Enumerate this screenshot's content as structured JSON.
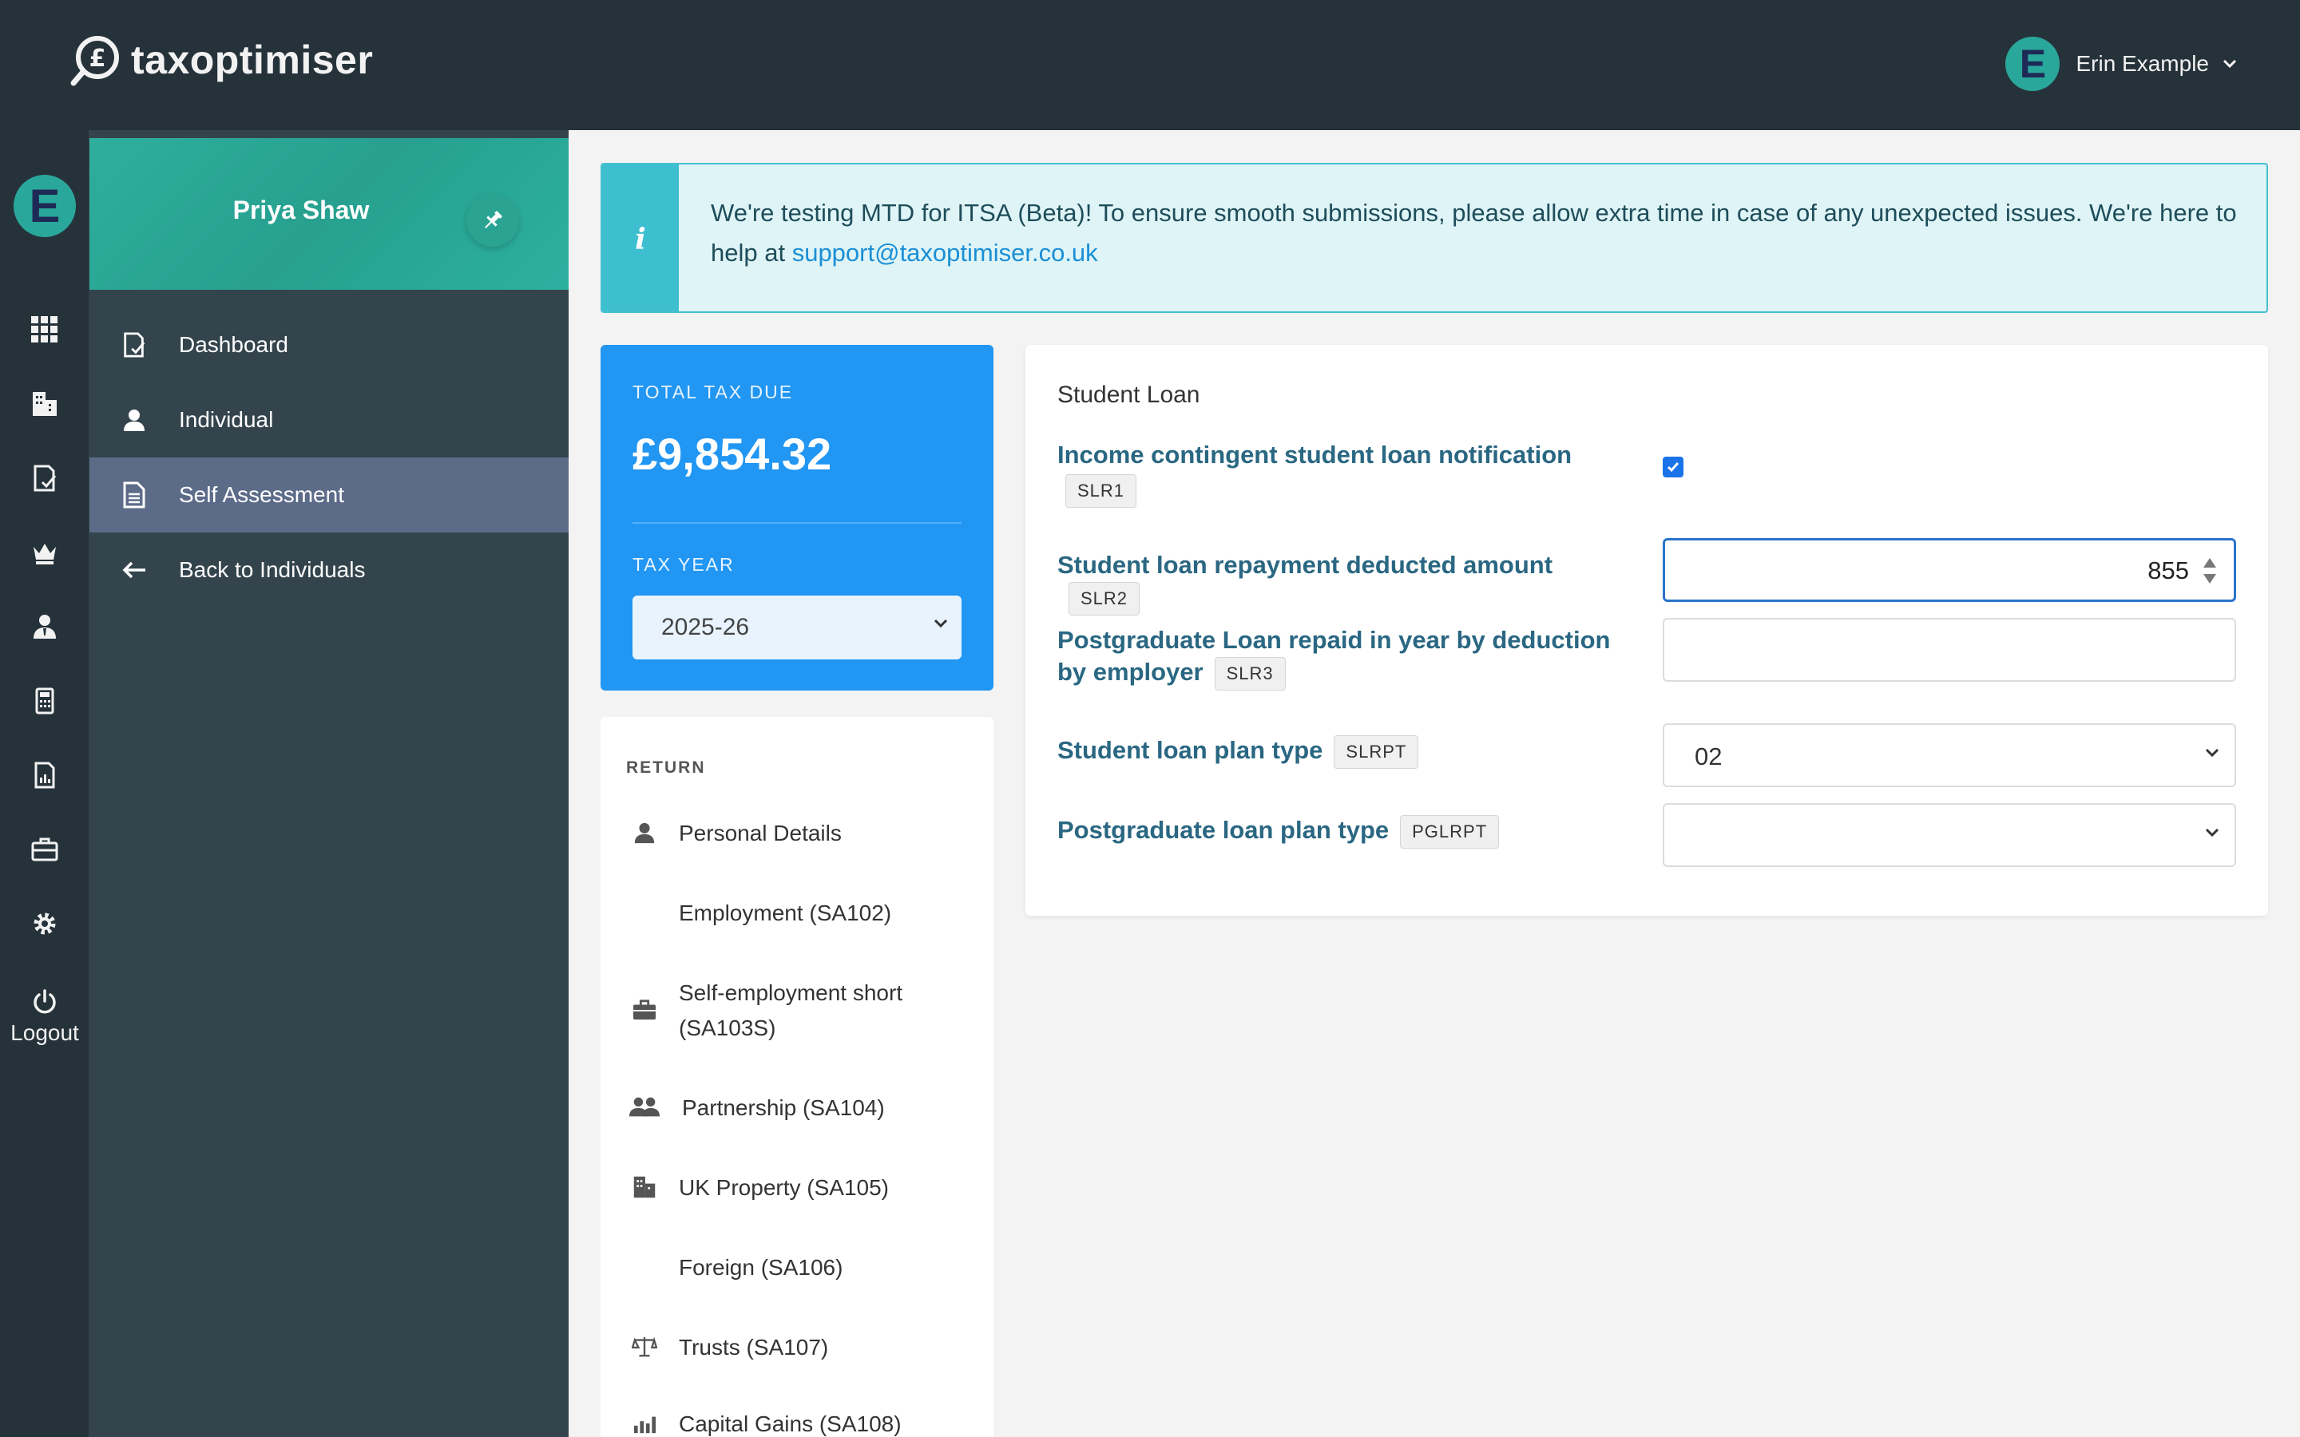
{
  "app": {
    "logo_text": "taxoptimiser",
    "user_name": "Erin Example",
    "user_initial": "E"
  },
  "rail": {
    "avatar_initial": "E",
    "icons": [
      "apps-grid-icon",
      "building-icon",
      "document-check-icon",
      "crown-icon",
      "user-tie-icon",
      "calculator-icon",
      "report-icon",
      "briefcase-icon",
      "gear-icon"
    ],
    "logout_label": "Logout"
  },
  "sidenav": {
    "client_name": "Priya Shaw",
    "items": [
      {
        "label": "Dashboard",
        "icon": "document-check-icon",
        "active": false
      },
      {
        "label": "Individual",
        "icon": "user-icon",
        "active": false
      },
      {
        "label": "Self Assessment",
        "icon": "document-icon",
        "active": true
      },
      {
        "label": "Back to Individuals",
        "icon": "arrow-left-icon",
        "active": false
      }
    ]
  },
  "notice": {
    "text": "We're testing MTD for ITSA (Beta)! To ensure smooth submissions, please allow extra time in case of any unexpected issues. We're here to help at ",
    "link": "support@taxoptimiser.co.uk"
  },
  "tax": {
    "label": "TOTAL TAX DUE",
    "amount": "£9,854.32",
    "year_label": "TAX YEAR",
    "year_value": "2025-26"
  },
  "return_nav": {
    "label": "RETURN",
    "items": [
      {
        "label": "Personal Details",
        "icon": "user-icon"
      },
      {
        "label": "Employment (SA102)",
        "icon": ""
      },
      {
        "label": "Self-employment short (SA103S)",
        "icon": "briefcase-icon"
      },
      {
        "label": "Partnership (SA104)",
        "icon": "users-icon"
      },
      {
        "label": "UK Property (SA105)",
        "icon": "building-icon"
      },
      {
        "label": "Foreign (SA106)",
        "icon": ""
      },
      {
        "label": "Trusts (SA107)",
        "icon": "scales-icon"
      },
      {
        "label": "Capital Gains (SA108)",
        "icon": "chart-icon"
      }
    ]
  },
  "form": {
    "title": "Student Loan",
    "fields": [
      {
        "label": "Income contingent student loan notification",
        "code": "SLR1",
        "type": "checkbox",
        "checked": true
      },
      {
        "label": "Student loan repayment deducted amount",
        "code": "SLR2",
        "type": "number",
        "value": "855"
      },
      {
        "label": "Postgraduate Loan repaid in year by deduction by employer",
        "code": "SLR3",
        "type": "number",
        "value": ""
      },
      {
        "label": "Student loan plan type",
        "code": "SLRPT",
        "type": "select",
        "value": "02"
      },
      {
        "label": "Postgraduate loan plan type",
        "code": "PGLRPT",
        "type": "select",
        "value": ""
      }
    ]
  },
  "colors": {
    "topbar": "#26323a",
    "teal": "#2aa79b",
    "blue": "#2196f3",
    "label": "#2a6782",
    "active_nav": "#5c6b88"
  }
}
